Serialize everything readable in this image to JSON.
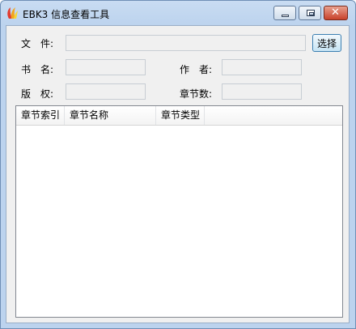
{
  "window": {
    "title": "EBK3 信息查看工具",
    "controls": {
      "minimize": "minimize-icon",
      "maximize": "maximize-icon",
      "close": "close-icon"
    },
    "close_glyph": "✕"
  },
  "form": {
    "file_label": "文　件:",
    "file_value": "",
    "pick_button": "选择",
    "bookname_label": "书　名:",
    "bookname_value": "",
    "author_label": "作　者:",
    "author_value": "",
    "copyright_label": "版　权:",
    "copyright_value": "",
    "chapter_count_label": "章节数:",
    "chapter_count_value": ""
  },
  "chapter_list": {
    "columns": [
      "章节索引",
      "章节名称",
      "章节类型"
    ],
    "rows": []
  },
  "colors": {
    "accent": "#3c7fb1",
    "close_button": "#c8422b",
    "frame": "#bcd3ee"
  }
}
